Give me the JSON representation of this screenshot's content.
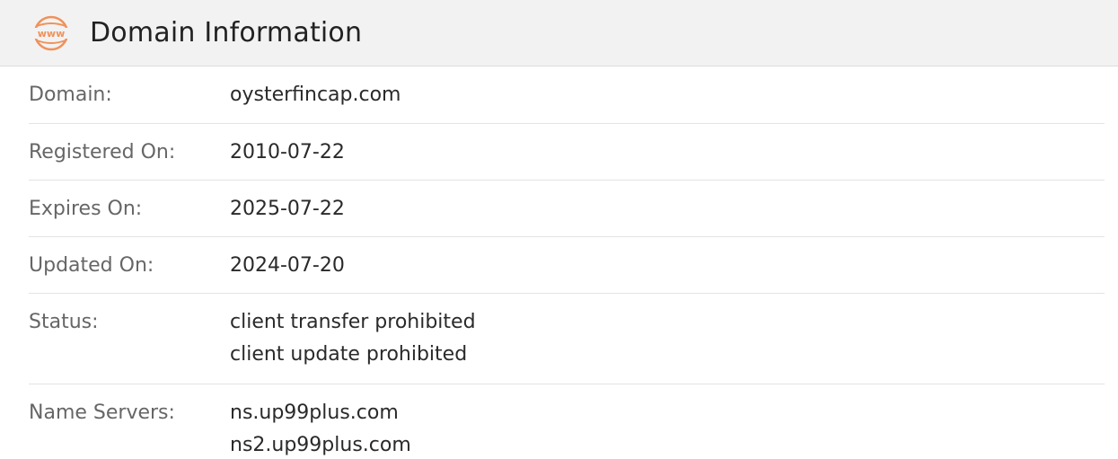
{
  "header": {
    "icon": "www-globe-icon",
    "icon_text": "www",
    "accent_color": "#f0915a",
    "title": "Domain Information"
  },
  "rows": {
    "domain": {
      "label": "Domain:",
      "value": "oysterfincap.com"
    },
    "registered": {
      "label": "Registered On:",
      "value": "2010-07-22"
    },
    "expires": {
      "label": "Expires On:",
      "value": "2025-07-22"
    },
    "updated": {
      "label": "Updated On:",
      "value": "2024-07-20"
    },
    "status": {
      "label": "Status:",
      "values": [
        "client transfer prohibited",
        "client update prohibited"
      ]
    },
    "name_servers": {
      "label": "Name Servers:",
      "values": [
        "ns.up99plus.com",
        "ns2.up99plus.com"
      ]
    }
  }
}
